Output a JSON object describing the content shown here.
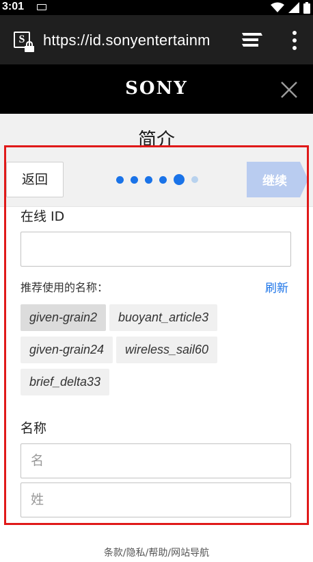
{
  "status_bar": {
    "time": "3:01",
    "icons": [
      "keyboard-icon",
      "wifi-icon",
      "signal-icon",
      "battery-icon"
    ]
  },
  "browser": {
    "url": "https://id.sonyentertainm",
    "icons": [
      "site-favicon-icon",
      "lock-icon",
      "tabs-icon",
      "overflow-menu-icon"
    ]
  },
  "header": {
    "logo": "SONY",
    "close_icon": "close-icon"
  },
  "page": {
    "title": "简介"
  },
  "nav": {
    "back_label": "返回",
    "continue_label": "继续",
    "steps_total": 6,
    "current_step": 5
  },
  "form": {
    "online_id_label": "在线 ID",
    "online_id_value": "",
    "suggestions_label": "推荐使用的名称：",
    "refresh_label": "刷新",
    "suggestions": [
      "given-grain2",
      "buoyant_article3",
      "given-grain24",
      "wireless_sail60",
      "brief_delta33"
    ],
    "name_label": "名称",
    "first_name_placeholder": "名",
    "last_name_placeholder": "姓"
  },
  "footer": {
    "links": "条款/隐私/帮助/网站导航"
  },
  "colors": {
    "accent": "#1a73e8",
    "continue_disabled": "#b9ccf0",
    "highlight_frame": "#e01919",
    "header_bg": "#000000",
    "urlbar_bg": "#1f1f1f"
  }
}
